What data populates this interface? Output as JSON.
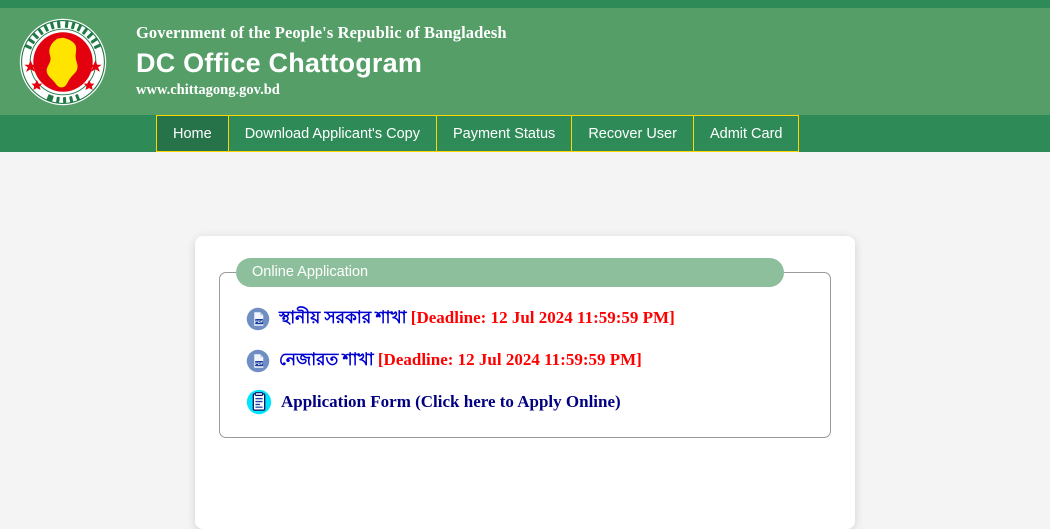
{
  "header": {
    "gov_line": "Government of the People's Republic of Bangladesh",
    "office_title": "DC Office Chattogram",
    "website": "www.chittagong.gov.bd",
    "emblem_name": "bangladesh-government-emblem",
    "band_color": "#559e67",
    "strip_color": "#2e8b57"
  },
  "nav": {
    "items": [
      {
        "label": "Home",
        "active": true
      },
      {
        "label": "Download Applicant's Copy",
        "active": false
      },
      {
        "label": "Payment Status",
        "active": false
      },
      {
        "label": "Recover User",
        "active": false
      },
      {
        "label": "Admit Card",
        "active": false
      }
    ],
    "border_color": "#ffd700",
    "active_bg": "#26734a",
    "bg": "#2e8b57"
  },
  "panel": {
    "legend": "Online Application",
    "legend_bg": "#8ebf9c",
    "rows": [
      {
        "icon": "pdf-file-icon",
        "label": "স্থানীয় সরকার শাখা",
        "label_color": "#0000d0",
        "deadline": "[Deadline: 12 Jul 2024 11:59:59 PM]",
        "deadline_color": "#ff0000"
      },
      {
        "icon": "pdf-file-icon",
        "label": "নেজারত শাখা",
        "label_color": "#0000d0",
        "deadline": "[Deadline: 12 Jul 2024 11:59:59 PM]",
        "deadline_color": "#ff0000"
      },
      {
        "icon": "application-form-icon",
        "label": "Application Form (Click here to Apply Online)",
        "label_color": "#000080",
        "deadline": "",
        "deadline_color": "#ff0000"
      }
    ]
  },
  "page": {
    "background": "#f4f4f4",
    "card_background": "#ffffff"
  }
}
